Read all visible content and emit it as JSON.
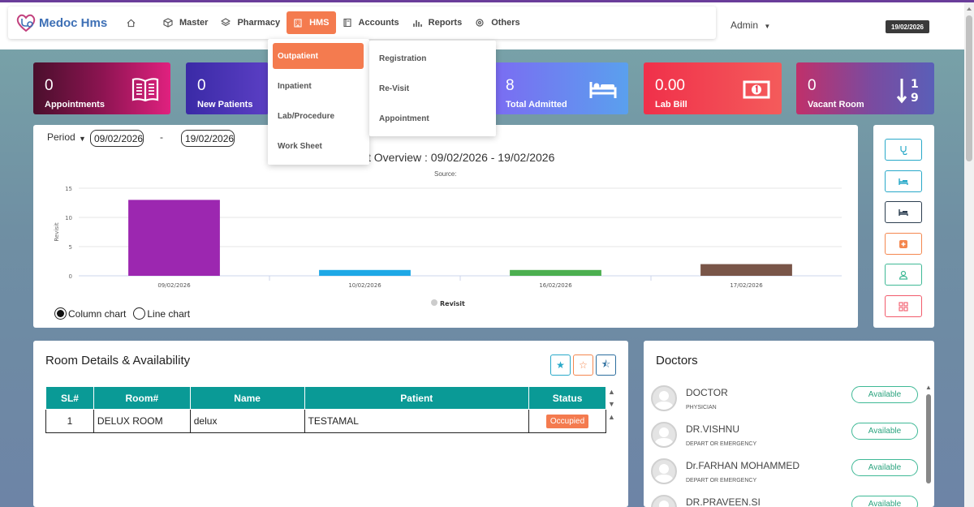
{
  "app": {
    "name": "Medoc Hms"
  },
  "nav": {
    "items": [
      {
        "label": "Master",
        "icon": "cube-icon"
      },
      {
        "label": "Pharmacy",
        "icon": "layers-icon"
      },
      {
        "label": "HMS",
        "icon": "building-icon",
        "active": true
      },
      {
        "label": "Accounts",
        "icon": "book-icon"
      },
      {
        "label": "Reports",
        "icon": "bar-chart-icon"
      },
      {
        "label": "Others",
        "icon": "gear-icon"
      }
    ]
  },
  "user": {
    "name": "Admin"
  },
  "header_date": "19/02/2026",
  "hms_menu": {
    "items": [
      "Outpatient",
      "Inpatient",
      "Lab/Procedure",
      "Work Sheet"
    ],
    "active": "Outpatient"
  },
  "outpatient_menu": {
    "items": [
      "Registration",
      "Re-Visit",
      "Appointment"
    ]
  },
  "stats": [
    {
      "value": "0",
      "label": "Appointments",
      "icon": "book-open-icon",
      "color": "#c2187a"
    },
    {
      "value": "0",
      "label": "New Patients",
      "icon": "user-plus-icon",
      "color": "#4a3fb8"
    },
    {
      "value": "8",
      "label": "Total Admitted",
      "icon": "bed-icon",
      "color": "#6a78f0"
    },
    {
      "value": "0.00",
      "label": "Lab Bill",
      "icon": "money-icon",
      "color": "#f23a4e"
    },
    {
      "value": "0",
      "label": "Vacant Room",
      "icon": "sort-numeric-icon",
      "color": "#7a4ba0"
    }
  ],
  "filters": {
    "period_label": "Period",
    "from_date": "09/02/2026",
    "separator": "-",
    "to_date": "19/02/2026"
  },
  "chart_data": {
    "type": "bar",
    "title_visible": "t Overview : 09/02/2026 - 19/02/2026",
    "subtitle": "Source:",
    "ylabel": "Revisit",
    "xlabel": "",
    "categories": [
      "09/02/2026",
      "10/02/2026",
      "16/02/2026",
      "17/02/2026"
    ],
    "series": [
      {
        "name": "Revisit",
        "values": [
          13,
          1,
          1,
          2
        ]
      }
    ],
    "bar_colors": [
      "#9c27b0",
      "#1ea8e6",
      "#4caf50",
      "#795548"
    ],
    "ylim": [
      0,
      15
    ],
    "yticks": [
      0,
      5,
      10,
      15
    ],
    "grid": true,
    "legend": "bottom-center"
  },
  "chart_type_options": {
    "column": "Column chart",
    "line": "Line chart",
    "selected": "Column chart"
  },
  "side_buttons": [
    {
      "icon": "stethoscope-icon",
      "color": "#29a9c9"
    },
    {
      "icon": "bed-icon",
      "color": "#29a9c9"
    },
    {
      "icon": "bed-dark-icon",
      "color": "#2c3e50"
    },
    {
      "icon": "first-aid-icon",
      "color": "#f4874f"
    },
    {
      "icon": "user-icon",
      "color": "#3fb996"
    },
    {
      "icon": "grid-icon",
      "color": "#f25b6b"
    }
  ],
  "rooms": {
    "title": "Room Details & Availability",
    "columns": [
      "SL#",
      "Room#",
      "Name",
      "Patient",
      "Status"
    ],
    "rows": [
      {
        "sl": "1",
        "room": "DELUX ROOM",
        "name": "delux",
        "patient": "TESTAMAL",
        "status": "Occupied"
      }
    ]
  },
  "doctors": {
    "title": "Doctors",
    "list": [
      {
        "name": "DOCTOR",
        "dept": "PHYSICIAN",
        "status": "Available"
      },
      {
        "name": "DR.VISHNU",
        "dept": "DEPART OR EMERGENCY",
        "status": "Available"
      },
      {
        "name": "Dr.FARHAN MOHAMMED",
        "dept": "DEPART OR EMERGENCY",
        "status": "Available"
      },
      {
        "name": "DR.PRAVEEN.SI",
        "dept": "",
        "status": "Available"
      }
    ]
  }
}
